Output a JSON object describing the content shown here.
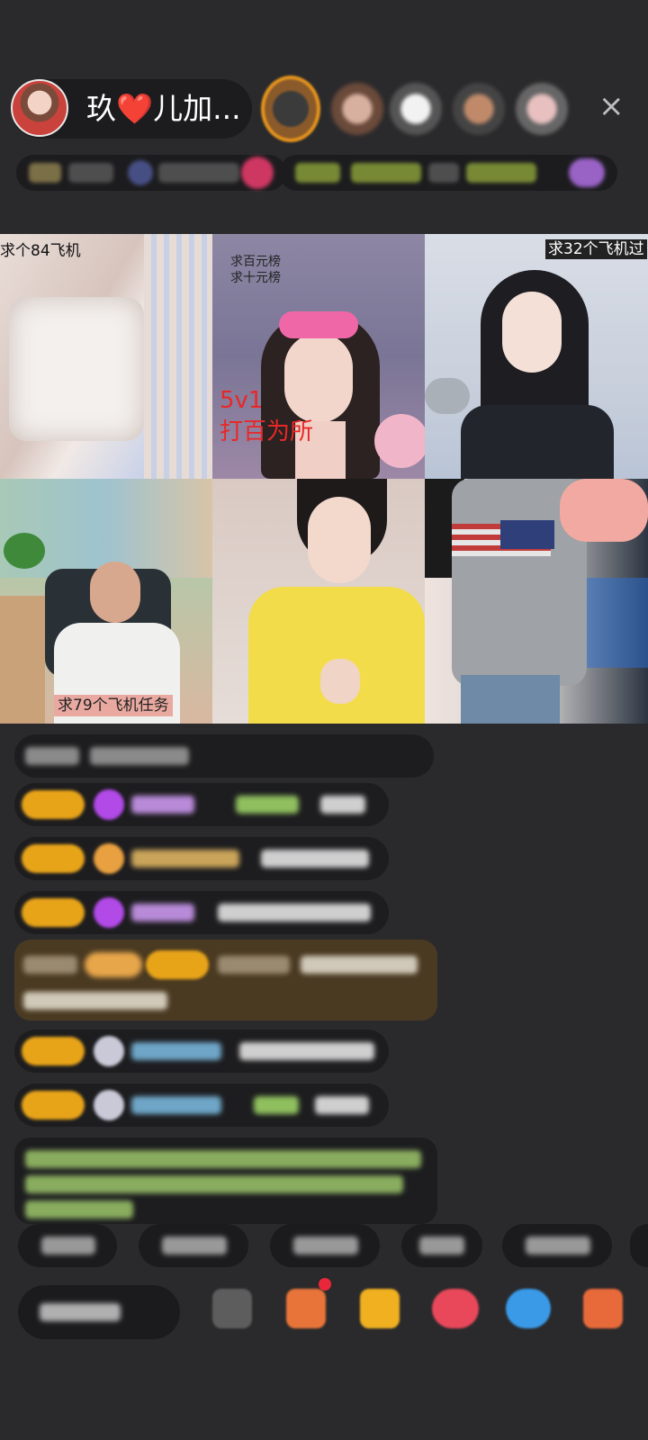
{
  "host": {
    "name_prefix": "玖",
    "heart": "❤️",
    "name_suffix": "儿加...",
    "close_icon": "×"
  },
  "tiles": [
    {
      "caption": "求个84飞机"
    },
    {
      "caption_top1": "求百元榜",
      "caption_top2": "求十元榜",
      "overlay": "5v1",
      "overlay2": "打百为所"
    },
    {
      "caption": "求32个飞机过"
    },
    {
      "caption": "求79个飞机任务"
    },
    {},
    {}
  ],
  "colors": {
    "background": "#2a2a2c",
    "level_badge": "#e8a419",
    "chat_green": "#9cc66a",
    "chat_cyan": "#6fa6c8",
    "highlight_bg": "#4a3a22"
  }
}
